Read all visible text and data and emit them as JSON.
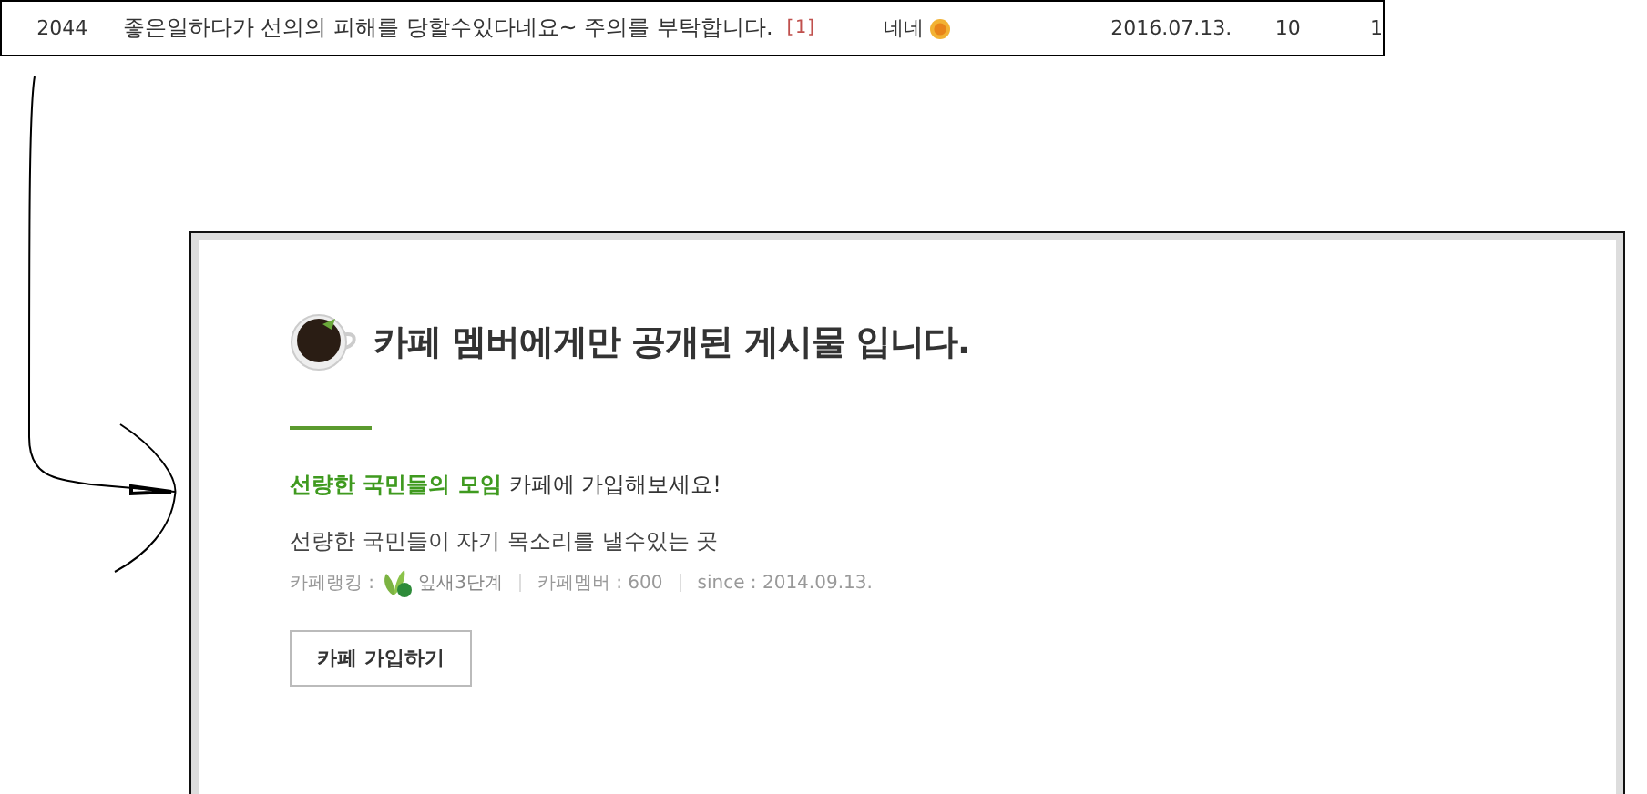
{
  "post_row": {
    "number": "2044",
    "title": "좋은일하다가 선의의 피해를 당할수있다네요~ 주의를 부탁합니다.",
    "comment_count": "[1]",
    "author": "네네",
    "date": "2016.07.13.",
    "views": "10",
    "likes": "1"
  },
  "notice": {
    "heading": "카페 멤버에게만 공개된 게시물 입니다.",
    "cafe_name": "선량한 국민들의 모임",
    "invite_text": "카페에 가입해보세요!",
    "description": "선량한 국민들이 자기 목소리를 낼수있는 곳",
    "ranking_label": "카페랭킹 :",
    "ranking": "잎새3단계",
    "members": "카페멤버 : 600",
    "since": "since : 2014.09.13.",
    "join_button": "카페 가입하기"
  }
}
